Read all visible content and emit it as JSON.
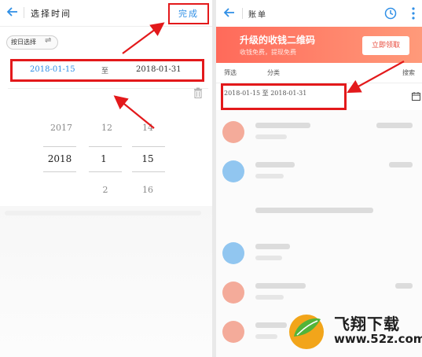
{
  "left": {
    "title": "选择时间",
    "done_label": "完成",
    "mode_label": "按日选择",
    "mode_icon": "swap-icon",
    "start_date": "2018-01-15",
    "to_label": "至",
    "end_date": "2018-01-31",
    "picker": {
      "years": [
        "2017",
        "2018"
      ],
      "months": [
        "12",
        "1",
        "2"
      ],
      "days": [
        "14",
        "15",
        "16"
      ]
    }
  },
  "right": {
    "title": "账单",
    "banner": {
      "title": "升级的收钱二维码",
      "subtitle": "收钱免费，提现免费",
      "button_label": "立即领取"
    },
    "filters": [
      "筛选",
      "分类",
      "搜索"
    ],
    "range_text": "2018-01-15 至 2018-01-31"
  },
  "watermark": {
    "title": "飞翔下载",
    "url": "www.52z.com"
  },
  "colors": {
    "accent": "#2f8fe6",
    "highlight": "#e3191b",
    "banner": "#ff7a66"
  }
}
